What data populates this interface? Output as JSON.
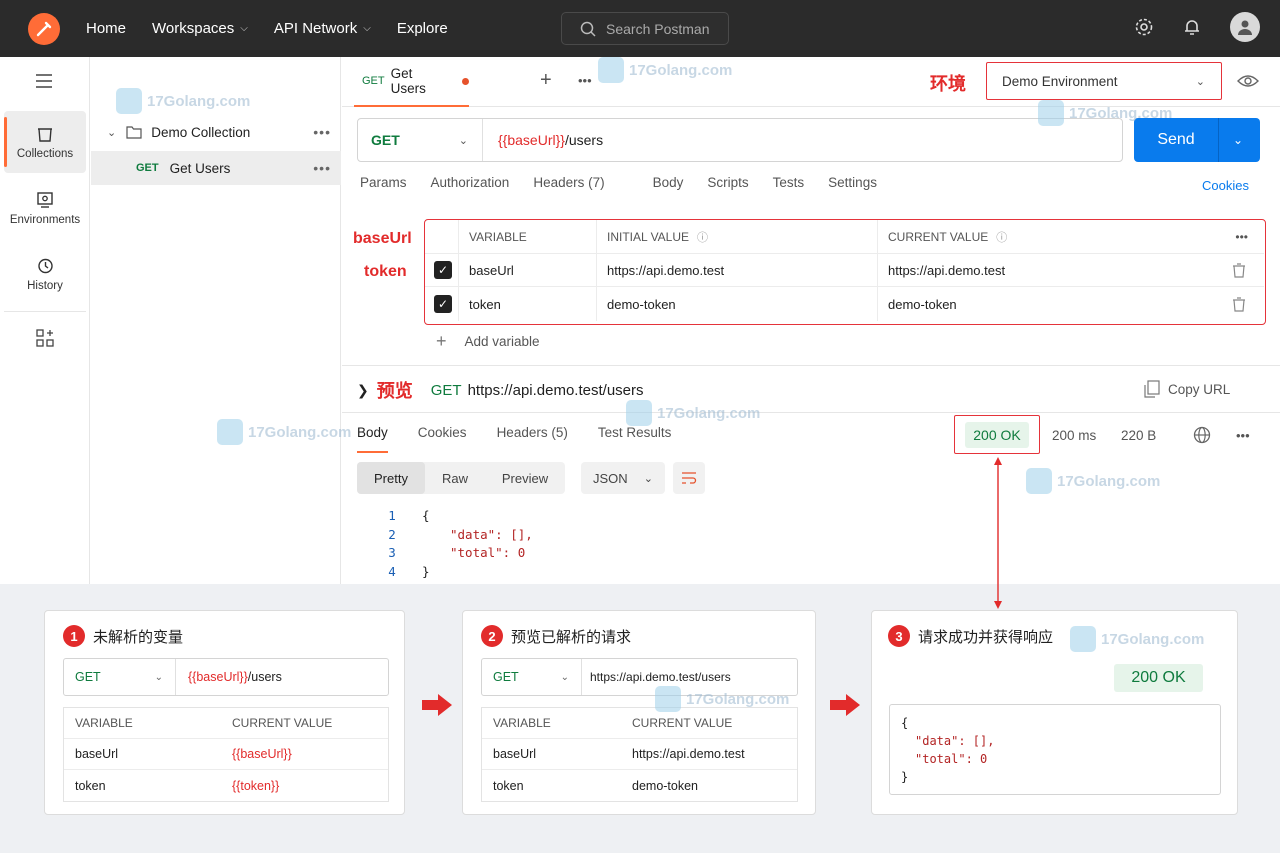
{
  "topbar": {
    "nav": [
      "Home",
      "Workspaces",
      "API Network",
      "Explore"
    ],
    "search_placeholder": "Search Postman"
  },
  "rail": {
    "items": [
      "Collections",
      "Environments",
      "History"
    ]
  },
  "sidebar": {
    "collection": "Demo Collection",
    "request_method": "GET",
    "request_name": "Get Users"
  },
  "tab": {
    "method": "GET",
    "name": "Get Users"
  },
  "env": {
    "annotation": "环境",
    "selected": "Demo Environment"
  },
  "request": {
    "method": "GET",
    "url_var": "{{baseUrl}}",
    "url_path": "/users",
    "send": "Send",
    "tabs": [
      "Params",
      "Authorization",
      "Headers (7)",
      "Body",
      "Scripts",
      "Tests",
      "Settings"
    ],
    "cookies": "Cookies"
  },
  "vars": {
    "annotations": [
      "baseUrl",
      "token"
    ],
    "headers": [
      "VARIABLE",
      "INITIAL VALUE",
      "CURRENT VALUE"
    ],
    "rows": [
      {
        "name": "baseUrl",
        "initial": "https://api.demo.test",
        "current": "https://api.demo.test"
      },
      {
        "name": "token",
        "initial": "demo-token",
        "current": "demo-token"
      }
    ],
    "add": "Add variable"
  },
  "preview": {
    "annotation": "预览",
    "method": "GET",
    "url": "https://api.demo.test/users",
    "copy": "Copy URL"
  },
  "response": {
    "tabs": [
      "Body",
      "Cookies",
      "Headers (5)",
      "Test Results"
    ],
    "status": "200 OK",
    "time": "200 ms",
    "size": "220 B",
    "views": [
      "Pretty",
      "Raw",
      "Preview"
    ],
    "format": "JSON",
    "lines": [
      "1",
      "2",
      "3",
      "4"
    ],
    "code": [
      "{",
      "\"data\": [],",
      "\"total\": 0",
      "}"
    ]
  },
  "steps": [
    {
      "num": "1",
      "title": "未解析的变量",
      "method": "GET",
      "url_var": "{{baseUrl}}",
      "url_path": "/users",
      "headers": [
        "VARIABLE",
        "CURRENT VALUE"
      ],
      "rows": [
        [
          "baseUrl",
          "{{baseUrl}}"
        ],
        [
          "token",
          "{{token}}"
        ]
      ]
    },
    {
      "num": "2",
      "title": "预览已解析的请求",
      "method": "GET",
      "url": "https://api.demo.test/users",
      "headers": [
        "VARIABLE",
        "CURRENT VALUE"
      ],
      "rows": [
        [
          "baseUrl",
          "https://api.demo.test"
        ],
        [
          "token",
          "demo-token"
        ]
      ]
    },
    {
      "num": "3",
      "title": "请求成功并获得响应",
      "status": "200 OK",
      "code": [
        "{",
        "\"data\": [],",
        "\"total\": 0",
        "}"
      ]
    }
  ],
  "watermark": "17Golang.com",
  "colors": {
    "accent": "#ff6c37",
    "send": "#097bed",
    "annotation": "#e22b2b",
    "method_green": "#0f7b3e"
  }
}
